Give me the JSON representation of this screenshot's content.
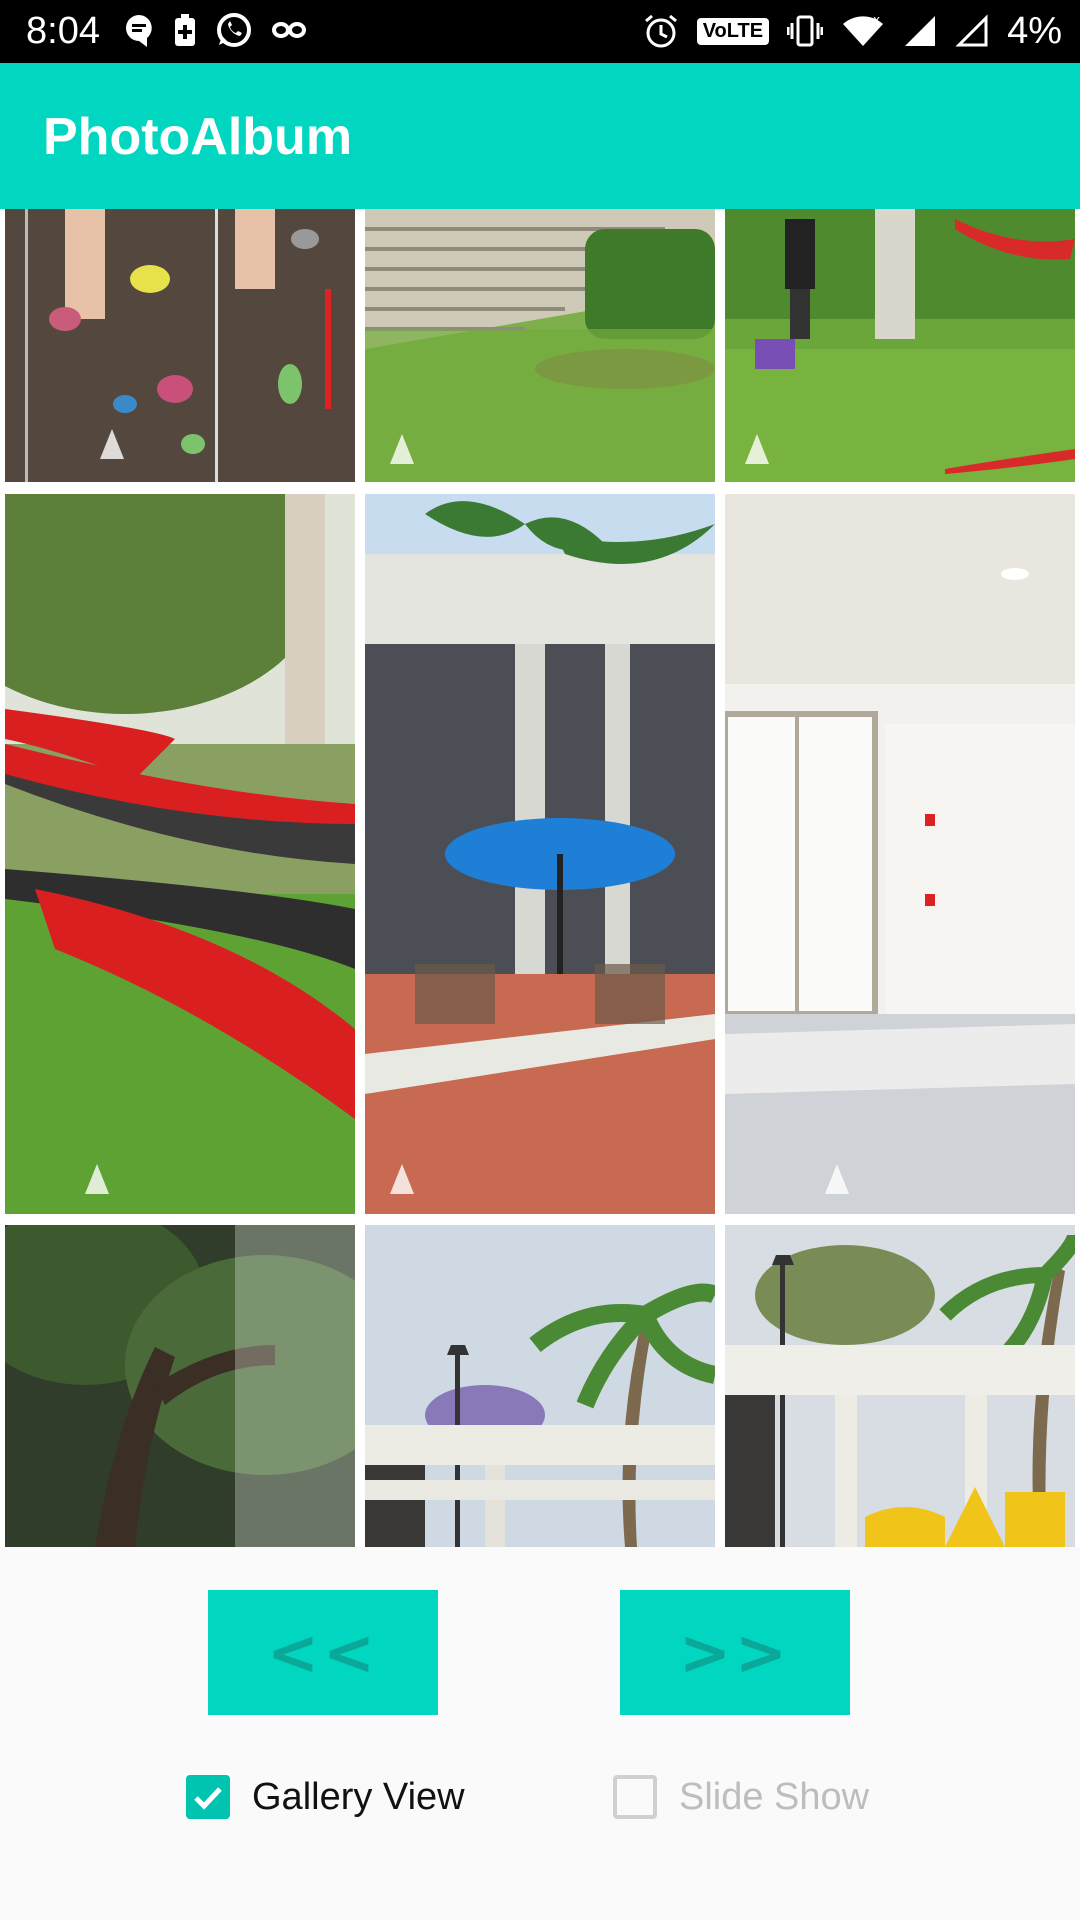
{
  "status_bar": {
    "time": "8:04",
    "volte": "VoLTE",
    "battery": "4%",
    "icons_left": [
      "message-icon",
      "battery-saver-icon",
      "whatsapp-icon",
      "infinity-icon"
    ],
    "icons_right": [
      "alarm-icon",
      "volte-icon",
      "vibrate-icon",
      "wifi-icon",
      "signal-icon",
      "signal-empty-icon"
    ]
  },
  "app_bar": {
    "title": "PhotoAlbum"
  },
  "gallery": {
    "photos": [
      {
        "name": "rock-climbing-wall"
      },
      {
        "name": "campus-steps-lawn"
      },
      {
        "name": "student-walking-hammock"
      },
      {
        "name": "red-hammocks-trees"
      },
      {
        "name": "courtyard-blue-umbrella"
      },
      {
        "name": "empty-white-room"
      },
      {
        "name": "tree-canopy"
      },
      {
        "name": "palm-trees-lamp-post"
      },
      {
        "name": "campus-building-yellow-sign"
      }
    ]
  },
  "controls": {
    "prev_label": "<<",
    "next_label": ">>",
    "gallery_view_label": "Gallery View",
    "gallery_view_checked": true,
    "slide_show_label": "Slide Show",
    "slide_show_checked": false
  },
  "colors": {
    "accent": "#00d6c0",
    "accent_dark": "#0aa898",
    "status_bar": "#000000"
  }
}
